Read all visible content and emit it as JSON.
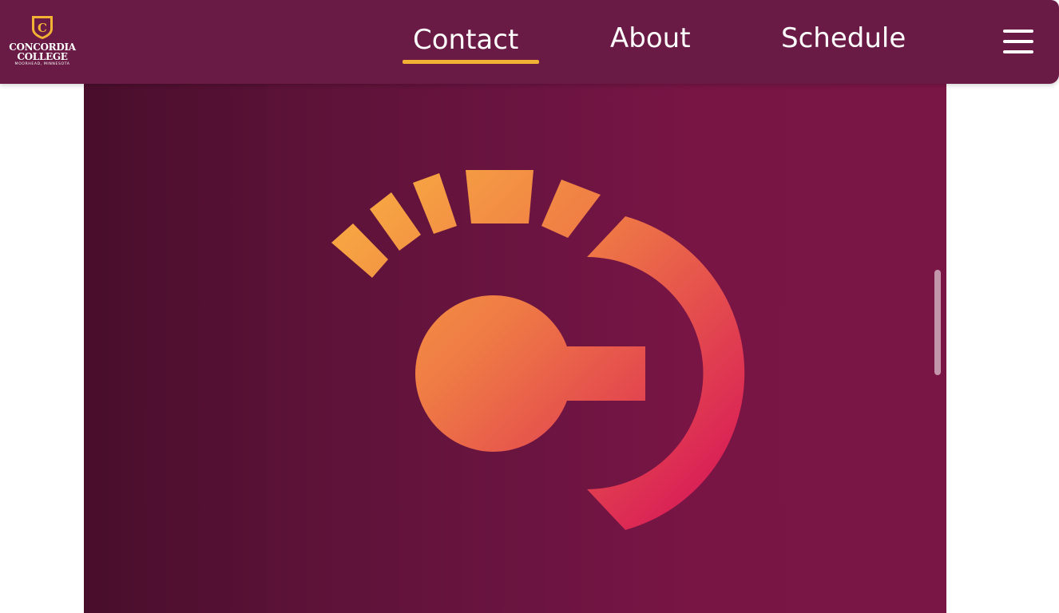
{
  "header": {
    "brand": {
      "line1": "CONCORDIA",
      "line2": "COLLEGE",
      "line3": "MOORHEAD, MINNESOTA",
      "shield_letter": "C",
      "shield_color": "#f2b233"
    },
    "nav": [
      {
        "label": "Contact",
        "active": true
      },
      {
        "label": "About",
        "active": false
      },
      {
        "label": "Schedule",
        "active": false
      }
    ],
    "menu_icon": "hamburger-menu-icon",
    "background_color": "#6a1b45",
    "active_underline_color": "#f2b233"
  },
  "hero": {
    "image": "concordia-c-gauge-logo",
    "gradient_colors": [
      "#f6a540",
      "#d81b57"
    ]
  }
}
